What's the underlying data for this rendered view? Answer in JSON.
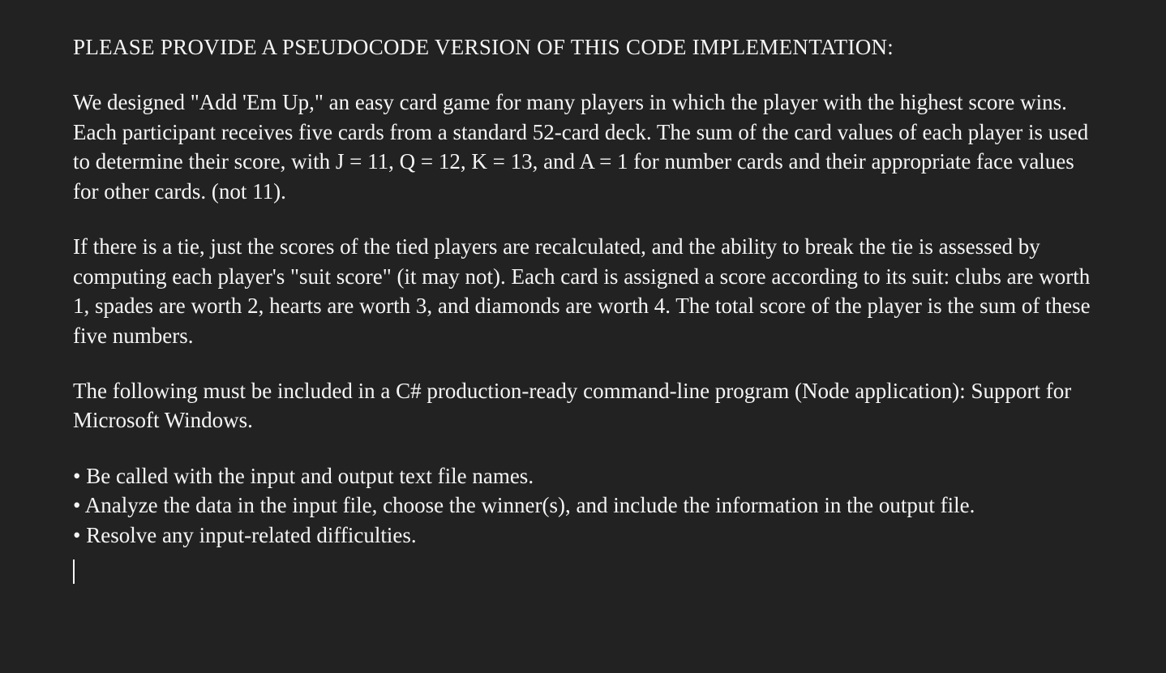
{
  "heading": "PLEASE PROVIDE A PSEUDOCODE VERSION OF THIS CODE IMPLEMENTATION:",
  "paragraph1": "We designed \"Add 'Em Up,\" an easy card game for many players in which the player with the highest score wins. Each participant receives five cards from a standard 52-card deck. The sum of the card values of each player is used to determine their score, with J = 11, Q = 12, K = 13, and A = 1 for number cards and their appropriate face values for other cards. (not 11).",
  "paragraph2": "If there is a tie, just the scores of the tied players are recalculated, and the ability to break the tie is assessed by computing each player's \"suit score\" (it may not). Each card is assigned a score according to its suit: clubs are worth 1, spades are worth 2, hearts are worth 3, and diamonds are worth 4. The total score of the player is the sum of these five numbers.",
  "paragraph3": "The following must be included in a C# production-ready command-line program (Node application): Support for Microsoft Windows.",
  "bullets": [
    "• Be called with the input and output text file names.",
    "• Analyze the data in the input file, choose the winner(s), and include the information in the output file.",
    "• Resolve any input-related difficulties."
  ]
}
